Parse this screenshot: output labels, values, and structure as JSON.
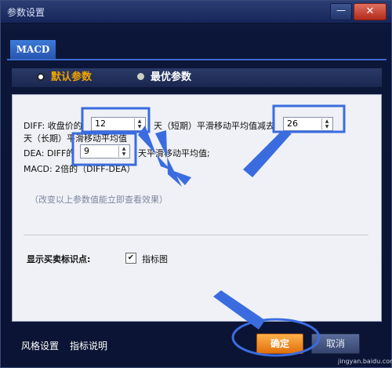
{
  "window": {
    "title": "参数设置",
    "close": "✕",
    "minimize": "—"
  },
  "tab": {
    "label": "MACD"
  },
  "modes": {
    "default": "默认参数",
    "optimal": "最优参数"
  },
  "params": {
    "diff_prefix": "DIFF: 收盘价的",
    "diff_short": "12",
    "diff_mid": "天（短期）平滑移动平均值减去",
    "diff_long": "26",
    "diff_suffix": "天（长期）平滑移动平均值",
    "dea_prefix": "DEA: DIFF的",
    "dea_value": "9",
    "dea_suffix": "天平滑移动平均值;",
    "macd": "MACD: 2倍的（DIFF-DEA）"
  },
  "hint": "（改变以上参数值能立即查看效果）",
  "signal": {
    "label": "显示买卖标识点:",
    "checkbox": "指标图",
    "checked": true
  },
  "footer": {
    "style": "风格设置",
    "explain": "指标说明",
    "ok": "确定",
    "cancel": "取消"
  },
  "watermark": "jingyan.baidu.com",
  "colors": {
    "accent": "#f2a300",
    "annotation": "#3a6ce0"
  }
}
